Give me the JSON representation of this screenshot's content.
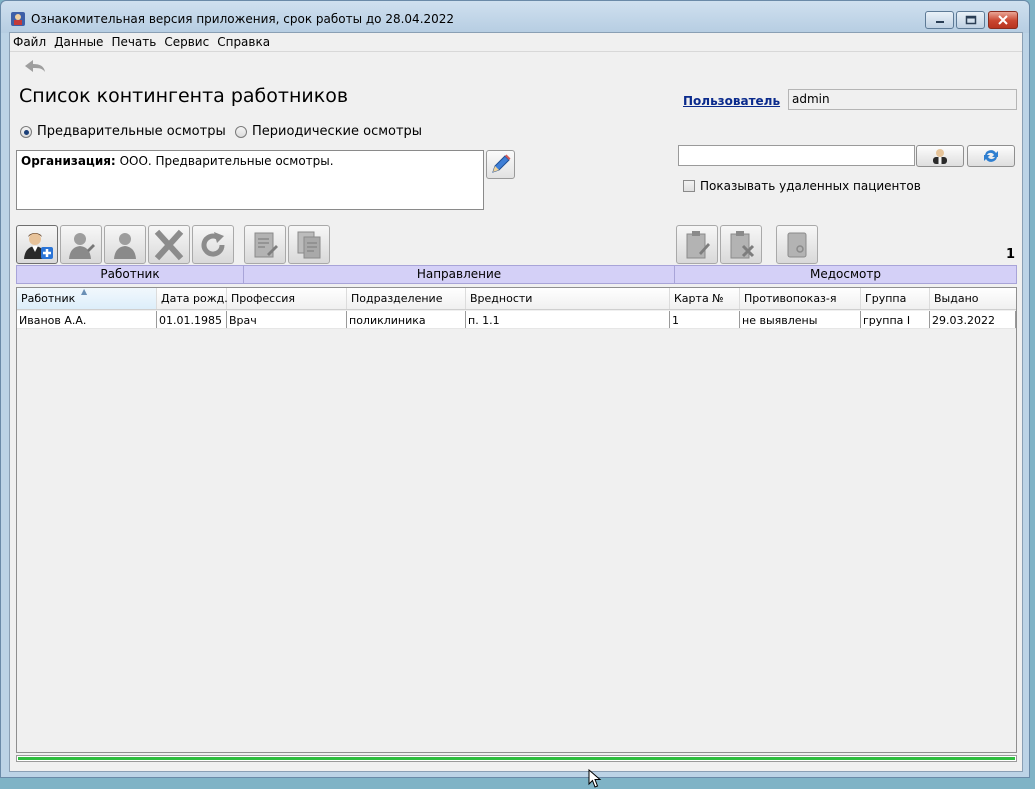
{
  "window": {
    "title": "Ознакомительная версия приложения, срок работы до 28.04.2022"
  },
  "menu": [
    "Файл",
    "Данные",
    "Печать",
    "Сервис",
    "Справка"
  ],
  "page": {
    "title": "Список контингента работников",
    "user_label": "Пользователь",
    "user_value": "admin"
  },
  "exam_type": {
    "options": [
      "Предварительные осмотры",
      "Периодические осмотры"
    ],
    "selected": "Предварительные осмотры"
  },
  "organization": {
    "label": "Организация:",
    "value": "ООО. Предварительные осмотры."
  },
  "search": {
    "value": "",
    "show_deleted_label": "Показывать удаленных пациентов",
    "show_deleted_checked": false
  },
  "record_count": "1",
  "grid": {
    "groups": [
      "Работник",
      "Направление",
      "Медосмотр"
    ],
    "columns": [
      "Работник",
      "Дата рожд.",
      "Профессия",
      "Подразделение",
      "Вредности",
      "Карта №",
      "Противопоказ-я",
      "Группа",
      "Выдано"
    ],
    "sorted_column": "Работник",
    "rows": [
      [
        "Иванов А.А.",
        "01.01.1985",
        "Врач",
        "поликлиника",
        "п. 1.1",
        "1",
        "не выявлены",
        "группа I",
        "29.03.2022"
      ]
    ]
  },
  "progress": 1.0,
  "icons": {
    "app": "app-icon",
    "back": "back-arrow-icon",
    "edit": "pencil-icon",
    "user_search": "user-search-icon",
    "refresh": "refresh-icon"
  },
  "colors": {
    "group_header_bg": "#d4d0f7",
    "user_link": "#0a2a8c",
    "progress": "#2fbd3f",
    "title_bar": "#bcd3e6"
  }
}
